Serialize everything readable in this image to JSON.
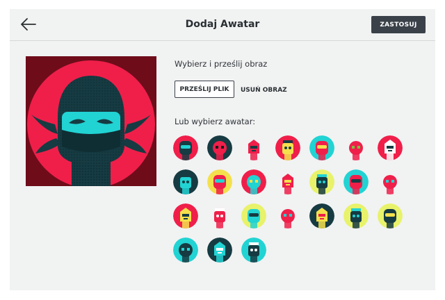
{
  "header": {
    "title": "Dodaj Awatar",
    "apply_label": "ZASTOSUJ",
    "back_icon": "arrow-left-icon"
  },
  "preview": {
    "icon": "ninja-avatar-icon",
    "colors": {
      "frame": "#6e0c1a",
      "circle": "#ef1f4a",
      "hood": "#163b42",
      "eyes": "#22d3d3"
    }
  },
  "upload": {
    "label": "Wybierz i prześlij obraz",
    "upload_button": "PRZEŚLIJ PLIK",
    "remove_button": "USUŃ OBRAZ"
  },
  "avatars": {
    "label": "Lub wybierz awatar:",
    "items": [
      {
        "name": "ninja",
        "bg": "#ef1f4a",
        "head": "#163b42",
        "accent": "#22d3d3"
      },
      {
        "name": "masked-robber",
        "bg": "#163b42",
        "head": "#ef1f4a",
        "accent": "#1a1a1a"
      },
      {
        "name": "bearded-hat",
        "bg": "#f2f2f2",
        "head": "#ef1f4a",
        "accent": "#163b42"
      },
      {
        "name": "chef",
        "bg": "#ef1f4a",
        "head": "#f4e04d",
        "accent": "#163b42"
      },
      {
        "name": "king",
        "bg": "#22d3d3",
        "head": "#ef1f4a",
        "accent": "#f4e04d"
      },
      {
        "name": "samurai",
        "bg": "#f2f2f2",
        "head": "#ef1f4a",
        "accent": "#7fbf3f"
      },
      {
        "name": "skull-red",
        "bg": "#ef1f4a",
        "head": "#ffffff",
        "accent": "#163b42"
      },
      {
        "name": "skull-dark",
        "bg": "#163b42",
        "head": "#22d3d3",
        "accent": "#163b42"
      },
      {
        "name": "lion",
        "bg": "#f4e04d",
        "head": "#ef1f4a",
        "accent": "#22d3d3"
      },
      {
        "name": "clown",
        "bg": "#ef1f4a",
        "head": "#22d3d3",
        "accent": "#f4e04d"
      },
      {
        "name": "tiki",
        "bg": "#f2f2f2",
        "head": "#ef1f4a",
        "accent": "#f4e04d"
      },
      {
        "name": "robot-green",
        "bg": "#e8f26a",
        "head": "#163b42",
        "accent": "#22d3d3"
      },
      {
        "name": "devil",
        "bg": "#22d3d3",
        "head": "#ef1f4a",
        "accent": "#163b42"
      },
      {
        "name": "astronaut-red",
        "bg": "#f2f2f2",
        "head": "#ef1f4a",
        "accent": "#22d3d3"
      },
      {
        "name": "blob-yellow",
        "bg": "#ef1f4a",
        "head": "#f4e04d",
        "accent": "#163b42"
      },
      {
        "name": "popsicle",
        "bg": "#f2f2f2",
        "head": "#ef1f4a",
        "accent": "#ffffff"
      },
      {
        "name": "goblin",
        "bg": "#e8f26a",
        "head": "#22d3d3",
        "accent": "#163b42"
      },
      {
        "name": "clown-red",
        "bg": "#f2f2f2",
        "head": "#ef1f4a",
        "accent": "#22d3d3"
      },
      {
        "name": "helmet-dark",
        "bg": "#163b42",
        "head": "#f4e04d",
        "accent": "#ef1f4a"
      },
      {
        "name": "diver",
        "bg": "#e8f26a",
        "head": "#163b42",
        "accent": "#22d3d3"
      },
      {
        "name": "alien",
        "bg": "#e8f26a",
        "head": "#163b42",
        "accent": "#f4e04d"
      },
      {
        "name": "robot-cyan",
        "bg": "#22d3d3",
        "head": "#163b42",
        "accent": "#22d3d3"
      },
      {
        "name": "space-helmet",
        "bg": "#163b42",
        "head": "#22d3d3",
        "accent": "#ffffff"
      },
      {
        "name": "skull-robot",
        "bg": "#22d3d3",
        "head": "#163b42",
        "accent": "#ffffff"
      }
    ]
  }
}
